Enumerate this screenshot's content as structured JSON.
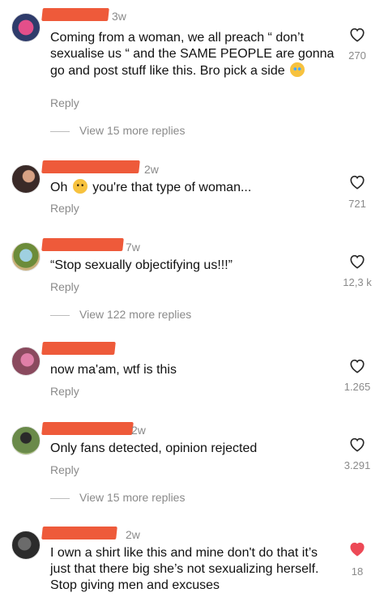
{
  "comments": [
    {
      "time": "3w",
      "text_a": "Coming from a woman, we all preach “ don’t sexualise us “ and the SAME PEOPLE are gonna go and post stuff like this. Bro pick a side",
      "emoji": "crying-laughing-emoji",
      "reply_label": "Reply",
      "likes": "270",
      "liked": false,
      "view_more": "View 15 more replies"
    },
    {
      "time": "2w",
      "text_a": "Oh",
      "emoji": "confused-face-emoji",
      "text_b": "you're that type of woman...",
      "reply_label": "Reply",
      "likes": "721",
      "liked": false
    },
    {
      "time": "7w",
      "text_a": "“Stop sexually objectifying us!!!”",
      "reply_label": "Reply",
      "likes": "12,3 k",
      "liked": false,
      "view_more": "View 122 more replies"
    },
    {
      "time": "",
      "text_a": "now ma'am, wtf is this",
      "reply_label": "Reply",
      "likes": "1.265",
      "liked": false
    },
    {
      "time": "2w",
      "text_a": "Only fans detected, opinion rejected",
      "reply_label": "Reply",
      "likes": "3.291",
      "liked": false,
      "view_more": "View 15 more replies"
    },
    {
      "time": "2w",
      "text_a": "I own a shirt like this and mine don't do that it’s just that there big she’s not sexualizing herself. Stop giving men and excuses",
      "likes": "18",
      "liked": true
    }
  ],
  "colors": {
    "redaction": "#ee5a3a",
    "muted_text": "#8a8a8a",
    "liked_heart": "#ed4956"
  }
}
